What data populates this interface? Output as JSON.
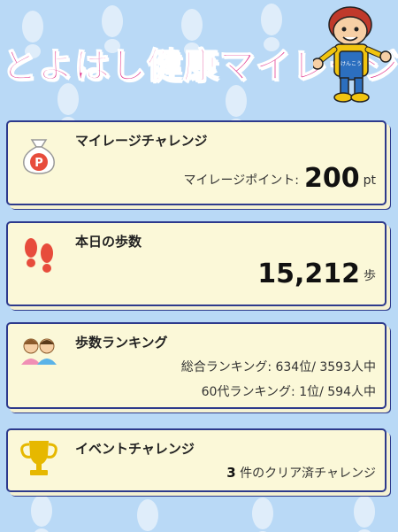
{
  "header": {
    "title": "とよはし健康マイレージ"
  },
  "mileage": {
    "title": "マイレージチャレンジ",
    "points_label": "マイレージポイント:",
    "points_value": "200",
    "points_unit": "pt"
  },
  "steps": {
    "title": "本日の歩数",
    "value": "15,212",
    "unit": "歩"
  },
  "ranking": {
    "title": "歩数ランキング",
    "overall": "総合ランキング: 634位/ 3593人中",
    "age_group": "60代ランキング: 1位/ 594人中"
  },
  "event": {
    "title": "イベントチャレンジ",
    "count": "3",
    "count_suffix": " 件のクリア済チャレンジ"
  },
  "colors": {
    "background": "#b9d9f6",
    "card_fill": "#fbf8d8",
    "card_border": "#2d3a8c",
    "title_pink": "#e0338b"
  }
}
